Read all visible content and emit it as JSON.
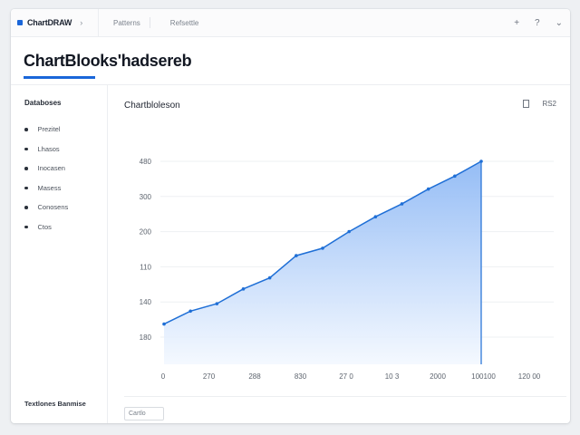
{
  "window": {
    "brand": "ChartDRAW",
    "nav": [
      "Patterns",
      "Refsettle"
    ],
    "icons": [
      "plus-icon",
      "help-icon",
      "chevron-down-icon"
    ]
  },
  "header": {
    "title": "ChartBlooks'hadsereb"
  },
  "sidebar": {
    "heading": "Databoses",
    "items": [
      {
        "label": "Prezitel"
      },
      {
        "label": "Lhasos"
      },
      {
        "label": "Inocasen"
      },
      {
        "label": "Masess"
      },
      {
        "label": "Conosens"
      },
      {
        "label": "Ctos"
      }
    ],
    "footer": "Textlones Banmise"
  },
  "main": {
    "chart_title": "Chartbloleson",
    "tool_label": "RS2",
    "input_value": "Cartlo"
  },
  "colors": {
    "accent": "#1a66d9",
    "line": "#1f6fd6",
    "area_top": "#8fb9f5",
    "area_bottom": "#f3f8ff"
  },
  "chart_data": {
    "type": "area",
    "x_tick_labels": [
      "0",
      "270",
      "288",
      "830",
      "27 0",
      "10 3",
      "2000",
      "100100",
      "120 00"
    ],
    "y_tick_labels": [
      "180",
      "140",
      "110",
      "200",
      "300",
      "480"
    ],
    "x": [
      0,
      1,
      2,
      3,
      4,
      5,
      6,
      7,
      8,
      9,
      10,
      11,
      12
    ],
    "values": [
      1,
      1.7,
      2.1,
      2.9,
      3.5,
      4.7,
      5.1,
      6.0,
      6.8,
      7.5,
      8.3,
      9.0,
      9.8
    ],
    "grid": true,
    "legend": "none"
  }
}
